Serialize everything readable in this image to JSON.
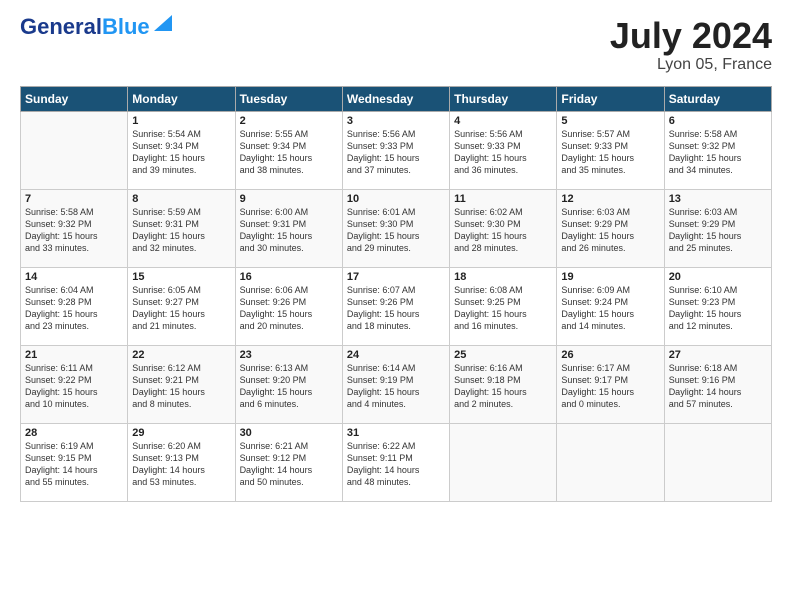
{
  "header": {
    "logo_line1": "General",
    "logo_line2": "Blue",
    "month_title": "July 2024",
    "location": "Lyon 05, France"
  },
  "weekdays": [
    "Sunday",
    "Monday",
    "Tuesday",
    "Wednesday",
    "Thursday",
    "Friday",
    "Saturday"
  ],
  "weeks": [
    [
      {
        "day": "",
        "text": ""
      },
      {
        "day": "1",
        "text": "Sunrise: 5:54 AM\nSunset: 9:34 PM\nDaylight: 15 hours\nand 39 minutes."
      },
      {
        "day": "2",
        "text": "Sunrise: 5:55 AM\nSunset: 9:34 PM\nDaylight: 15 hours\nand 38 minutes."
      },
      {
        "day": "3",
        "text": "Sunrise: 5:56 AM\nSunset: 9:33 PM\nDaylight: 15 hours\nand 37 minutes."
      },
      {
        "day": "4",
        "text": "Sunrise: 5:56 AM\nSunset: 9:33 PM\nDaylight: 15 hours\nand 36 minutes."
      },
      {
        "day": "5",
        "text": "Sunrise: 5:57 AM\nSunset: 9:33 PM\nDaylight: 15 hours\nand 35 minutes."
      },
      {
        "day": "6",
        "text": "Sunrise: 5:58 AM\nSunset: 9:32 PM\nDaylight: 15 hours\nand 34 minutes."
      }
    ],
    [
      {
        "day": "7",
        "text": "Sunrise: 5:58 AM\nSunset: 9:32 PM\nDaylight: 15 hours\nand 33 minutes."
      },
      {
        "day": "8",
        "text": "Sunrise: 5:59 AM\nSunset: 9:31 PM\nDaylight: 15 hours\nand 32 minutes."
      },
      {
        "day": "9",
        "text": "Sunrise: 6:00 AM\nSunset: 9:31 PM\nDaylight: 15 hours\nand 30 minutes."
      },
      {
        "day": "10",
        "text": "Sunrise: 6:01 AM\nSunset: 9:30 PM\nDaylight: 15 hours\nand 29 minutes."
      },
      {
        "day": "11",
        "text": "Sunrise: 6:02 AM\nSunset: 9:30 PM\nDaylight: 15 hours\nand 28 minutes."
      },
      {
        "day": "12",
        "text": "Sunrise: 6:03 AM\nSunset: 9:29 PM\nDaylight: 15 hours\nand 26 minutes."
      },
      {
        "day": "13",
        "text": "Sunrise: 6:03 AM\nSunset: 9:29 PM\nDaylight: 15 hours\nand 25 minutes."
      }
    ],
    [
      {
        "day": "14",
        "text": "Sunrise: 6:04 AM\nSunset: 9:28 PM\nDaylight: 15 hours\nand 23 minutes."
      },
      {
        "day": "15",
        "text": "Sunrise: 6:05 AM\nSunset: 9:27 PM\nDaylight: 15 hours\nand 21 minutes."
      },
      {
        "day": "16",
        "text": "Sunrise: 6:06 AM\nSunset: 9:26 PM\nDaylight: 15 hours\nand 20 minutes."
      },
      {
        "day": "17",
        "text": "Sunrise: 6:07 AM\nSunset: 9:26 PM\nDaylight: 15 hours\nand 18 minutes."
      },
      {
        "day": "18",
        "text": "Sunrise: 6:08 AM\nSunset: 9:25 PM\nDaylight: 15 hours\nand 16 minutes."
      },
      {
        "day": "19",
        "text": "Sunrise: 6:09 AM\nSunset: 9:24 PM\nDaylight: 15 hours\nand 14 minutes."
      },
      {
        "day": "20",
        "text": "Sunrise: 6:10 AM\nSunset: 9:23 PM\nDaylight: 15 hours\nand 12 minutes."
      }
    ],
    [
      {
        "day": "21",
        "text": "Sunrise: 6:11 AM\nSunset: 9:22 PM\nDaylight: 15 hours\nand 10 minutes."
      },
      {
        "day": "22",
        "text": "Sunrise: 6:12 AM\nSunset: 9:21 PM\nDaylight: 15 hours\nand 8 minutes."
      },
      {
        "day": "23",
        "text": "Sunrise: 6:13 AM\nSunset: 9:20 PM\nDaylight: 15 hours\nand 6 minutes."
      },
      {
        "day": "24",
        "text": "Sunrise: 6:14 AM\nSunset: 9:19 PM\nDaylight: 15 hours\nand 4 minutes."
      },
      {
        "day": "25",
        "text": "Sunrise: 6:16 AM\nSunset: 9:18 PM\nDaylight: 15 hours\nand 2 minutes."
      },
      {
        "day": "26",
        "text": "Sunrise: 6:17 AM\nSunset: 9:17 PM\nDaylight: 15 hours\nand 0 minutes."
      },
      {
        "day": "27",
        "text": "Sunrise: 6:18 AM\nSunset: 9:16 PM\nDaylight: 14 hours\nand 57 minutes."
      }
    ],
    [
      {
        "day": "28",
        "text": "Sunrise: 6:19 AM\nSunset: 9:15 PM\nDaylight: 14 hours\nand 55 minutes."
      },
      {
        "day": "29",
        "text": "Sunrise: 6:20 AM\nSunset: 9:13 PM\nDaylight: 14 hours\nand 53 minutes."
      },
      {
        "day": "30",
        "text": "Sunrise: 6:21 AM\nSunset: 9:12 PM\nDaylight: 14 hours\nand 50 minutes."
      },
      {
        "day": "31",
        "text": "Sunrise: 6:22 AM\nSunset: 9:11 PM\nDaylight: 14 hours\nand 48 minutes."
      },
      {
        "day": "",
        "text": ""
      },
      {
        "day": "",
        "text": ""
      },
      {
        "day": "",
        "text": ""
      }
    ]
  ]
}
